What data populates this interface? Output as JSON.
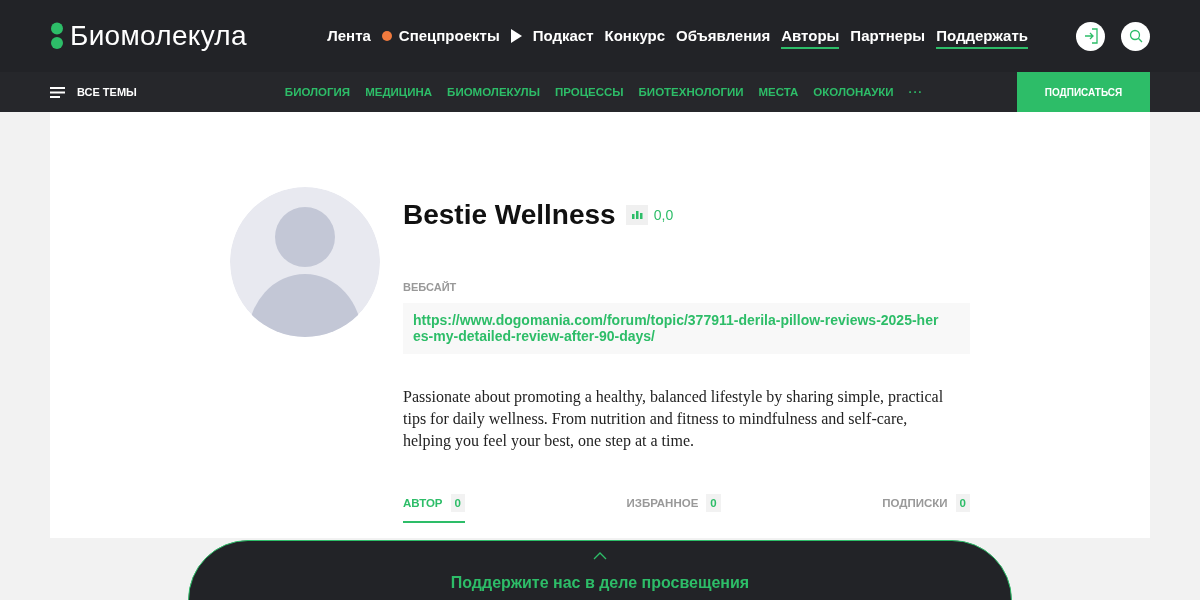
{
  "header": {
    "logo": "Биомолекула",
    "nav": [
      {
        "label": "Лента",
        "kind": "plain",
        "selected": false
      },
      {
        "label": "Спецпроекты",
        "kind": "dot",
        "selected": false
      },
      {
        "label": "Подкаст",
        "kind": "play",
        "selected": false
      },
      {
        "label": "Конкурс",
        "kind": "plain",
        "selected": false
      },
      {
        "label": "Объявления",
        "kind": "plain",
        "selected": false
      },
      {
        "label": "Авторы",
        "kind": "plain",
        "selected": true
      },
      {
        "label": "Партнеры",
        "kind": "plain",
        "selected": false
      },
      {
        "label": "Поддержать",
        "kind": "plain",
        "selected": true
      }
    ]
  },
  "topics_bar": {
    "all_topics": "ВСЕ ТЕМЫ",
    "topics": [
      "БИОЛОГИЯ",
      "МЕДИЦИНА",
      "БИОМОЛЕКУЛЫ",
      "ПРОЦЕССЫ",
      "БИОТЕХНОЛОГИИ",
      "МЕСТА",
      "ОКОЛОНАУКИ"
    ],
    "more": "···",
    "subscribe": "ПОДПИСАТЬСЯ"
  },
  "profile": {
    "name": "Bestie Wellness",
    "rating": "0,0",
    "website_label": "ВЕБСАЙТ",
    "website": "https://www.dogomania.com/forum/topic/377911-derila-pillow-reviews-2025-heres-my-detailed-review-after-90-days/",
    "bio": "Passionate about promoting a healthy, balanced lifestyle by sharing simple, practical tips for daily wellness. From nutrition and fitness to mindfulness and self-care, helping you feel your best, one step at a time.",
    "tabs": [
      {
        "label": "АВТОР",
        "count": "0",
        "selected": true
      },
      {
        "label": "ИЗБРАННОЕ",
        "count": "0",
        "selected": false
      },
      {
        "label": "ПОДПИСКИ",
        "count": "0",
        "selected": false
      }
    ]
  },
  "support_panel": {
    "title": "Поддержите нас в деле просвещения"
  }
}
